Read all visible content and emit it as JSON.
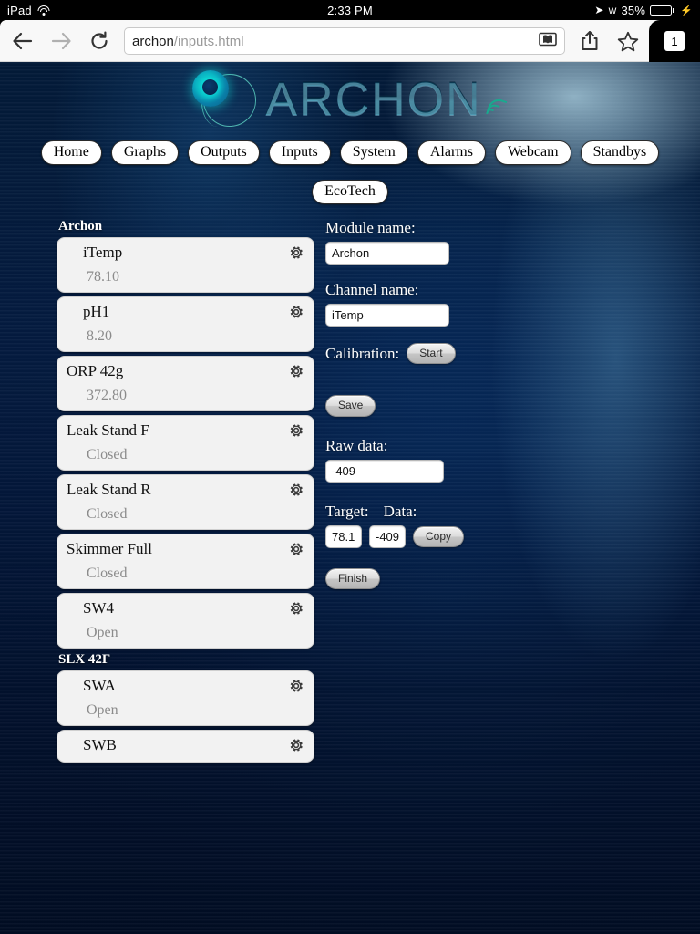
{
  "status_bar": {
    "device": "iPad",
    "wifi_icon": "wifi-icon",
    "time": "2:33 PM",
    "location_icon": "location-arrow-icon",
    "bluetooth_icon": "bluetooth-icon",
    "battery_percent": "35%",
    "battery_level": 35,
    "charging": true
  },
  "browser": {
    "back_icon": "back-arrow-icon",
    "forward_icon": "forward-arrow-icon",
    "reload_icon": "reload-icon",
    "url_host": "archon",
    "url_path": "/inputs.html",
    "reader_icon": "reader-view-icon",
    "share_icon": "share-icon",
    "bookmark_icon": "bookmark-star-icon",
    "tab_count": "1"
  },
  "header": {
    "logo_text": "ARCHON",
    "logo_mark_icon": "archon-emblem-icon",
    "signal_icon": "wifi-waves-icon"
  },
  "nav": {
    "items": [
      {
        "label": "Home"
      },
      {
        "label": "Graphs"
      },
      {
        "label": "Outputs"
      },
      {
        "label": "Inputs"
      },
      {
        "label": "System"
      },
      {
        "label": "Alarms"
      },
      {
        "label": "Webcam"
      },
      {
        "label": "Standbys"
      },
      {
        "label": "EcoTech"
      }
    ]
  },
  "sidebar": {
    "groups": [
      {
        "title": "Archon",
        "channels": [
          {
            "name": "iTemp",
            "value": "78.10",
            "indent": true,
            "gear_icon": "gear-icon"
          },
          {
            "name": "pH1",
            "value": "8.20",
            "indent": true,
            "gear_icon": "gear-icon"
          },
          {
            "name": "ORP 42g",
            "value": "372.80",
            "indent": false,
            "gear_icon": "gear-icon"
          },
          {
            "name": "Leak Stand F",
            "value": "Closed",
            "indent": false,
            "gear_icon": "gear-icon"
          },
          {
            "name": "Leak Stand R",
            "value": "Closed",
            "indent": false,
            "gear_icon": "gear-icon"
          },
          {
            "name": "Skimmer Full",
            "value": "Closed",
            "indent": false,
            "gear_icon": "gear-icon"
          },
          {
            "name": "SW4",
            "value": "Open",
            "indent": true,
            "gear_icon": "gear-icon"
          }
        ]
      },
      {
        "title": "SLX 42F",
        "channels": [
          {
            "name": "SWA",
            "value": "Open",
            "indent": true,
            "gear_icon": "gear-icon"
          },
          {
            "name": "SWB",
            "value": "",
            "indent": true,
            "gear_icon": "gear-icon",
            "truncated": true
          }
        ]
      }
    ]
  },
  "form": {
    "module_label": "Module name:",
    "module_value": "Archon",
    "channel_label": "Channel name:",
    "channel_value": "iTemp",
    "calibration_label": "Calibration:",
    "start_button": "Start",
    "save_button": "Save",
    "raw_data_label": "Raw data:",
    "raw_data_value": "-409",
    "target_label": "Target:",
    "data_label": "Data:",
    "target_value": "78.1",
    "data_value": "-409",
    "copy_button": "Copy",
    "finish_button": "Finish"
  },
  "colors": {
    "card_bg": "#f2f2f2",
    "value_text": "#8b8b8b",
    "water_light": "#a7dcf2",
    "water_deep": "#031a38",
    "battery_green": "#4cd964"
  }
}
